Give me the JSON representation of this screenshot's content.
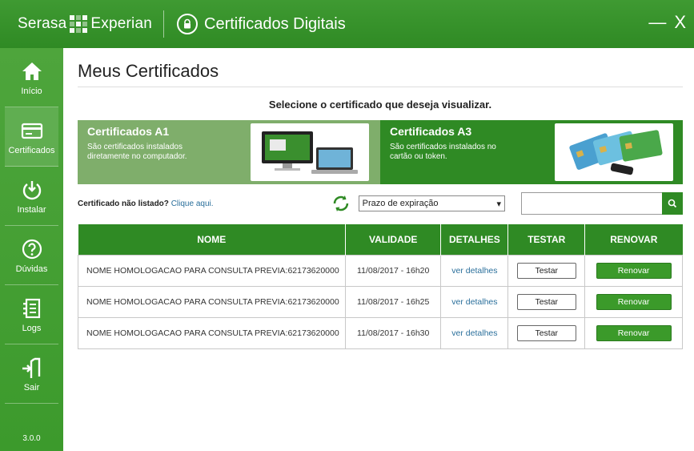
{
  "titlebar": {
    "brand_left": "Serasa",
    "brand_right": "Experian",
    "app_title": "Certificados Digitais",
    "minimize_label": "—",
    "close_label": "X"
  },
  "sidebar": {
    "items": [
      {
        "label": "Início",
        "icon": "home-icon"
      },
      {
        "label": "Certificados",
        "icon": "card-icon"
      },
      {
        "label": "Instalar",
        "icon": "power-download-icon"
      },
      {
        "label": "Dúvidas",
        "icon": "question-icon"
      },
      {
        "label": "Logs",
        "icon": "document-list-icon"
      },
      {
        "label": "Sair",
        "icon": "exit-icon"
      }
    ],
    "version": "3.0.0"
  },
  "main": {
    "title": "Meus Certificados",
    "subtitle": "Selecione o certificado que deseja visualizar.",
    "cards": [
      {
        "title": "Certificados A1",
        "desc": "São certificados instalados diretamente no computador."
      },
      {
        "title": "Certificados A3",
        "desc": "São certificados instalados no cartão ou token."
      }
    ],
    "not_listed_text": "Certificado não listado?",
    "not_listed_link": "Clique aqui.",
    "sort_select": "Prazo de expiração",
    "search_placeholder": ""
  },
  "table": {
    "headers": [
      "NOME",
      "VALIDADE",
      "DETALHES",
      "TESTAR",
      "RENOVAR"
    ],
    "rows": [
      {
        "name": "NOME HOMOLOGACAO PARA CONSULTA PREVIA:62173620000",
        "validity": "11/08/2017 - 16h20",
        "details": "ver detalhes",
        "test": "Testar",
        "renew": "Renovar"
      },
      {
        "name": "NOME HOMOLOGACAO PARA CONSULTA PREVIA:62173620000",
        "validity": "11/08/2017 - 16h25",
        "details": "ver detalhes",
        "test": "Testar",
        "renew": "Renovar"
      },
      {
        "name": "NOME HOMOLOGACAO PARA CONSULTA PREVIA:62173620000",
        "validity": "11/08/2017 - 16h30",
        "details": "ver detalhes",
        "test": "Testar",
        "renew": "Renovar"
      }
    ]
  },
  "colors": {
    "primary_green": "#2f8a24",
    "sidebar_green": "#4ea53c",
    "a1_green": "#7fae6b",
    "link_blue": "#2a6f9b"
  }
}
